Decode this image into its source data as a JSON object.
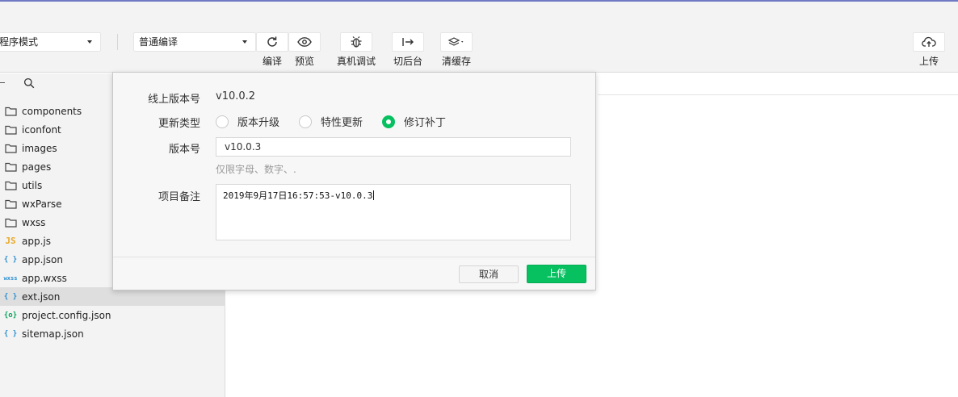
{
  "toolbar": {
    "mode_select": "程序模式",
    "compile_select": "普通编译",
    "buttons": {
      "compile": "编译",
      "preview": "预览",
      "debug": "真机调试",
      "background": "切后台",
      "clear_cache": "清缓存",
      "upload": "上传"
    }
  },
  "sidebar": {
    "files": [
      {
        "icon": "folder",
        "name": "components"
      },
      {
        "icon": "folder",
        "name": "iconfont"
      },
      {
        "icon": "folder",
        "name": "images"
      },
      {
        "icon": "folder",
        "name": "pages"
      },
      {
        "icon": "folder",
        "name": "utils"
      },
      {
        "icon": "folder",
        "name": "wxParse"
      },
      {
        "icon": "folder",
        "name": "wxss"
      },
      {
        "icon": "js",
        "glyph": "JS",
        "name": "app.js"
      },
      {
        "icon": "json",
        "glyph": "{ }",
        "name": "app.json"
      },
      {
        "icon": "wxss",
        "glyph": "wxss",
        "name": "app.wxss"
      },
      {
        "icon": "json",
        "glyph": "{ }",
        "name": "ext.json",
        "selected": true
      },
      {
        "icon": "config",
        "glyph": "{o}",
        "name": "project.config.json"
      },
      {
        "icon": "json",
        "glyph": "{ }",
        "name": "sitemap.json"
      }
    ]
  },
  "dialog": {
    "online_version_label": "线上版本号",
    "online_version_value": "v10.0.2",
    "update_type_label": "更新类型",
    "update_types": [
      {
        "label": "版本升级",
        "checked": false
      },
      {
        "label": "特性更新",
        "checked": false
      },
      {
        "label": "修订补丁",
        "checked": true
      }
    ],
    "version_label": "版本号",
    "version_value": "v10.0.3",
    "version_hint": "仅限字母、数字、.",
    "note_label": "项目备注",
    "note_value": "2019年9月17日16:57:53-v10.0.3",
    "cancel_label": "取消",
    "upload_label": "上传"
  },
  "colors": {
    "accent": "#07c160",
    "toolbar_bg": "#f3f3f3",
    "js_icon": "#e8a92a",
    "json_icon": "#2b8fd1",
    "config_icon": "#07a35a"
  }
}
